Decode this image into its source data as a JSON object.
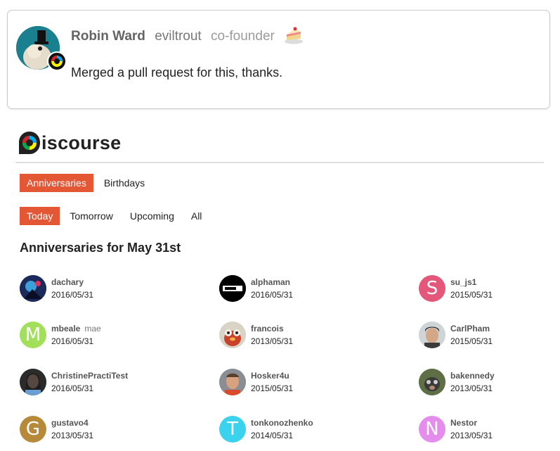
{
  "post": {
    "name": "Robin Ward",
    "username": "eviltrout",
    "title": "co-founder",
    "body": "Merged a pull request for this, thanks."
  },
  "logo": {
    "text": "iscourse"
  },
  "nav_main": [
    {
      "label": "Anniversaries",
      "active": true
    },
    {
      "label": "Birthdays",
      "active": false
    }
  ],
  "nav_sub": [
    {
      "label": "Today",
      "active": true
    },
    {
      "label": "Tomorrow",
      "active": false
    },
    {
      "label": "Upcoming",
      "active": false
    },
    {
      "label": "All",
      "active": false
    }
  ],
  "section_title": "Anniversaries for May 31st",
  "colors": {
    "accent": "#e45735",
    "su_js1": "#e4567a",
    "mbeale": "#a2e05c",
    "gustavo4": "#b78a3a",
    "tonkonozhenko": "#3bd2ee",
    "Nestor": "#e58ded"
  },
  "users": [
    {
      "name": "dachary",
      "date": "2016/05/31"
    },
    {
      "name": "alphaman",
      "date": "2016/05/31"
    },
    {
      "name": "su_js1",
      "date": "2015/05/31",
      "letter": "S"
    },
    {
      "name": "mbeale",
      "alias": "mae",
      "date": "2016/05/31",
      "letter": "M"
    },
    {
      "name": "francois",
      "date": "2013/05/31"
    },
    {
      "name": "CarlPham",
      "date": "2015/05/31"
    },
    {
      "name": "ChristinePractiTest",
      "date": "2016/05/31"
    },
    {
      "name": "Hosker4u",
      "date": "2015/05/31"
    },
    {
      "name": "bakennedy",
      "date": "2013/05/31"
    },
    {
      "name": "gustavo4",
      "date": "2013/05/31",
      "letter": "G"
    },
    {
      "name": "tonkonozhenko",
      "date": "2014/05/31",
      "letter": "T"
    },
    {
      "name": "Nestor",
      "date": "2013/05/31",
      "letter": "N"
    }
  ]
}
